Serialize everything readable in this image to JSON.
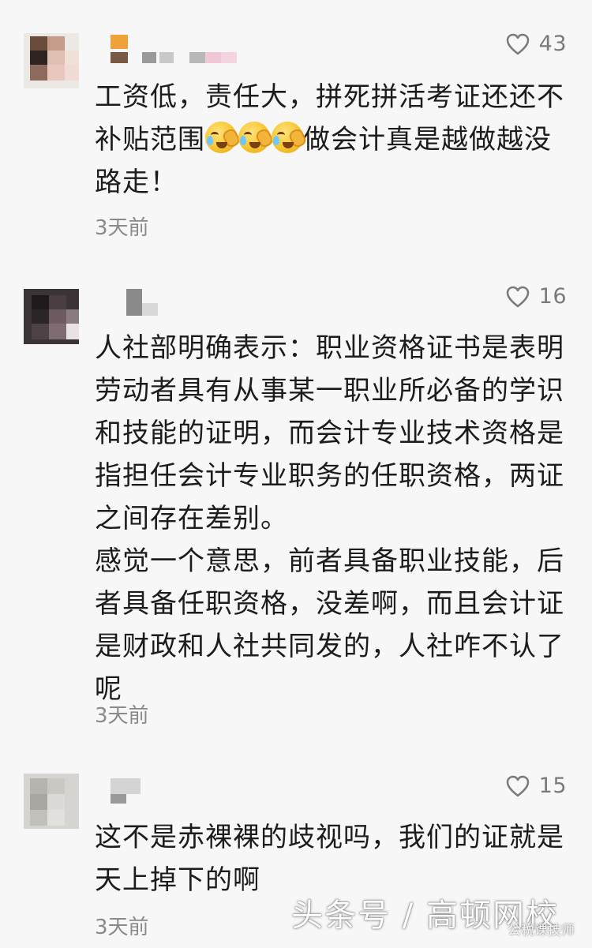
{
  "comments": [
    {
      "likes": "43",
      "paragraphs": [
        "工资低，责任大，拼死拼活考证还还不补贴范围",
        "做会计真是越做越没路走！"
      ],
      "emoji": "crying-face",
      "time": "3天前"
    },
    {
      "likes": "16",
      "paragraphs": [
        "人社部明确表示：职业资格证书是表明劳动者具有从事某一职业所必备的学识和技能的证明，而会计专业技术资格是指担任会计专业职务的任职资格，两证之间存在差别。",
        "感觉一个意思，前者具备职业技能，后者具备任职资格，没差啊，而且会计证是财政和人社共同发的，人社咋不认了呢"
      ],
      "time": "3天前"
    },
    {
      "likes": "15",
      "paragraphs": [
        "这不是赤裸裸的歧视吗，我们的证就是天上掉下的啊"
      ],
      "time": "3天前"
    }
  ],
  "watermark": "头条号 / 高顿网校",
  "watermark_small": "公税课技师",
  "icons": {
    "like": "heart-outline-icon"
  },
  "colors": {
    "background": "#f7f7f7",
    "text": "#1c1c1c",
    "muted": "#8a8a8a"
  }
}
